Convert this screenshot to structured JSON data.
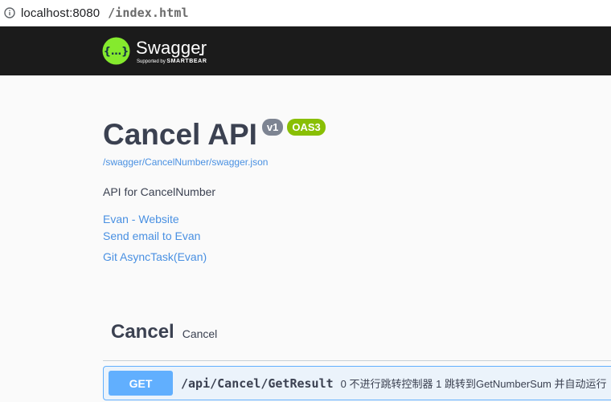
{
  "browser": {
    "url_host": "localhost:8080",
    "url_path": "/index.html"
  },
  "topbar": {
    "brand_name": "Swagger",
    "brand_sub_prefix": "Supported by ",
    "brand_sub_company": "SMARTBEAR",
    "logo_symbol": "{…}",
    "brand_color": "#85ea2d"
  },
  "info": {
    "title": "Cancel API",
    "version_badge": "v1",
    "oas_badge": "OAS3",
    "spec_url": "/swagger/CancelNumber/swagger.json",
    "description": "API for CancelNumber",
    "links": [
      "Evan - Website",
      "Send email to Evan",
      "Git AsyncTask(Evan)"
    ]
  },
  "tags": [
    {
      "name": "Cancel",
      "description": "Cancel",
      "operations": [
        {
          "method": "GET",
          "path": "/api/Cancel/GetResult",
          "summary": "0 不进行跳转控制器 1 跳转到GetNumberSum 并自动运行"
        }
      ]
    }
  ],
  "colors": {
    "get_method": "#61affe",
    "link": "#4990e2",
    "version_badge": "#7d8492",
    "oas_badge": "#89bf04"
  }
}
